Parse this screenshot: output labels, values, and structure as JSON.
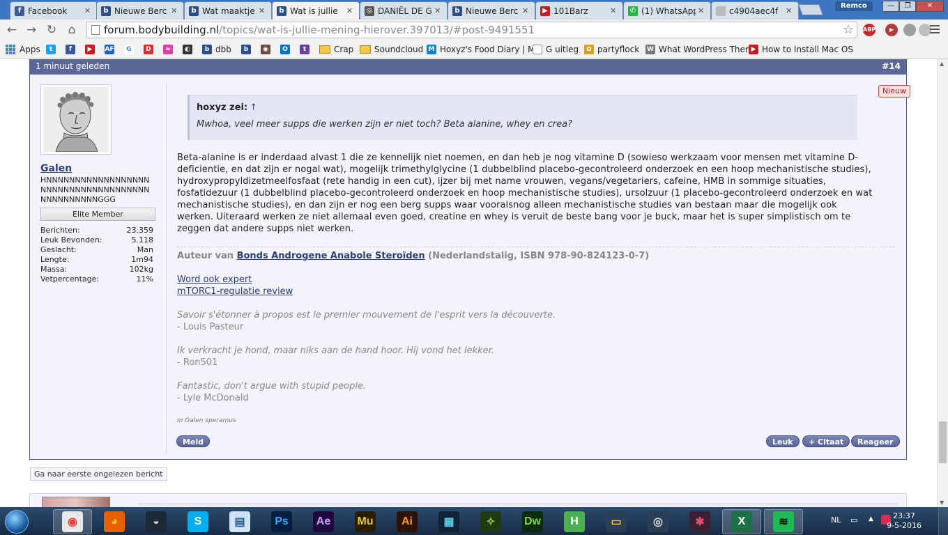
{
  "browser": {
    "tabs": [
      {
        "title": "Facebook",
        "color": "#3b5998",
        "glyph": "f",
        "active": false
      },
      {
        "title": "Nieuwe Berc",
        "color": "#2a4f8a",
        "glyph": "b",
        "active": false
      },
      {
        "title": "Wat maaktje",
        "color": "#2a4f8a",
        "glyph": "b",
        "active": false
      },
      {
        "title": "Wat is jullie",
        "color": "#2a4f8a",
        "glyph": "b",
        "active": true
      },
      {
        "title": "DANIËL DE G",
        "color": "#555555",
        "glyph": "◎",
        "active": false
      },
      {
        "title": "Nieuwe Berc",
        "color": "#2a4f8a",
        "glyph": "b",
        "active": false
      },
      {
        "title": "101Barz",
        "color": "#cc181e",
        "glyph": "▶",
        "active": false
      },
      {
        "title": "(1) WhatsApp",
        "color": "#2cb742",
        "glyph": "✆",
        "active": false
      },
      {
        "title": "c4904aec4f",
        "color": "#bbbbbb",
        "glyph": "",
        "active": false
      }
    ],
    "profile_name": "Remco",
    "url_host": "forum.bodybuilding.nl",
    "url_path": "/topics/wat-is-jullie-mening-hierover.397013/#post-9491551",
    "extensions": [
      {
        "name": "adblock-icon",
        "label": "ABP",
        "color": "#c62828"
      },
      {
        "name": "youtube-ext-icon",
        "label": "▶",
        "color": "#b43a3a"
      },
      {
        "name": "ext-grey-icon",
        "label": "",
        "color": "#9e9e9e"
      },
      {
        "name": "ext-grey2-icon",
        "label": "",
        "color": "#bdbdbd"
      }
    ],
    "bookmarks": [
      {
        "label": "Apps",
        "type": "apps"
      },
      {
        "label": "",
        "type": "icon",
        "color": "#1da1f2",
        "glyph": "t"
      },
      {
        "label": "",
        "type": "icon",
        "color": "#3b5998",
        "glyph": "f"
      },
      {
        "label": "",
        "type": "icon",
        "color": "#cc181e",
        "glyph": "▶"
      },
      {
        "label": "",
        "type": "icon",
        "color": "#1e63b5",
        "glyph": "AF"
      },
      {
        "label": "",
        "type": "icon",
        "color": "#ffffff",
        "glyph": "G"
      },
      {
        "label": "",
        "type": "icon",
        "color": "#d32f2f",
        "glyph": "D"
      },
      {
        "label": "",
        "type": "icon",
        "color": "#e040a0",
        "glyph": "∞"
      },
      {
        "label": "",
        "type": "icon",
        "color": "#333333",
        "glyph": "◐"
      },
      {
        "label": "dbb",
        "type": "icon",
        "color": "#2a4f8a",
        "glyph": "b"
      },
      {
        "label": "",
        "type": "icon",
        "color": "#2a4f8a",
        "glyph": "b"
      },
      {
        "label": "",
        "type": "icon",
        "color": "#6d4c41",
        "glyph": "◉"
      },
      {
        "label": "",
        "type": "icon",
        "color": "#0072c6",
        "glyph": "O"
      },
      {
        "label": "",
        "type": "icon",
        "color": "#6441a5",
        "glyph": "t"
      },
      {
        "label": "Crap",
        "type": "folder"
      },
      {
        "label": "Soundcloud",
        "type": "folder"
      },
      {
        "label": "Hoxyz's Food Diary | M",
        "type": "icon",
        "color": "#0d86c6",
        "glyph": "M"
      },
      {
        "label": "G uitleg",
        "type": "page"
      },
      {
        "label": "partyflock",
        "type": "icon",
        "color": "#d8a020",
        "glyph": "✿"
      },
      {
        "label": "What WordPress Then",
        "type": "icon",
        "color": "#777777",
        "glyph": "W"
      },
      {
        "label": "How to Install Mac OS",
        "type": "icon",
        "color": "#cc181e",
        "glyph": "▶"
      }
    ]
  },
  "post": {
    "time": "1 minuut geleden",
    "number": "#14",
    "new_badge": "Nieuw",
    "user": {
      "name": "Galen",
      "title": "HNNNNNNNNNNNNNNNNNNNNNNNNNNNNNNNNNNNNNNNNNNNNNNNGGG",
      "rank": "Elite Member",
      "stats": [
        {
          "label": "Berichten:",
          "value": "23.359"
        },
        {
          "label": "Leuk Bevonden:",
          "value": "5.118"
        },
        {
          "label": "Geslacht:",
          "value": "Man"
        },
        {
          "label": "Lengte:",
          "value": "1m94"
        },
        {
          "label": "Massa:",
          "value": "102kg"
        },
        {
          "label": "Vetpercentage:",
          "value": "11%"
        }
      ]
    },
    "quote": {
      "author": "hoxyz zei:",
      "arrow": "↑",
      "text": "Mwhoa, veel meer supps die werken zijn er niet toch? Beta alanine, whey en crea?"
    },
    "message": "Beta-alanine is er inderdaad alvast 1 die ze kennelijk niet noemen, en dan heb je nog vitamine D (sowieso werkzaam voor mensen met vitamine D-deficientie, en dat zijn er nogal wat), mogelijk trimethylglycine (1 dubbelblind placebo-gecontroleerd onderzoek en een hoop mechanistische studies), hydroxypropyldizetmeelfosfaat (rete handig in een cut), ijzer bij met name vrouwen, vegans/vegetariers, cafeine, HMB in sommige situaties, fosfatidezuur (1 dubbelblind placebo-gecontroleerd onderzoek en hoop mechanistische studies), ursolzuur (1 placebo-gecontroleerd onderzoek en wat mechanistische studies), en dan zijn er nog een berg supps waar vooralsnog alleen mechanistische studies van bestaan maar die mogelijk ook werken. Uiteraard werken ze niet allemaal even goed, creatine en whey is veruit de beste bang voor je buck, maar het is super simplistisch om te zeggen dat andere supps niet werken.",
    "signature": {
      "author_prefix": "Auteur van",
      "book_title": "Bonds Androgene Anabole Steroïden",
      "book_suffix": "(Nederlandstalig, ISBN 978-90-824123-0-7)",
      "link1": "Word ook expert",
      "link2": "mTORC1-regulatie review",
      "quotes": [
        {
          "text": "Savoir s'étonner à propos est le premier mouvement de l'esprit vers la découverte.",
          "by": "- Louis Pasteur"
        },
        {
          "text": "Ik verkracht je hond, maar niks aan de hand hoor. Hij vond het lekker.",
          "by": "- Ron501"
        },
        {
          "text": "Fantastic, don't argue with stupid people.",
          "by": "- Lyle McDonald"
        }
      ]
    },
    "in_galen": "In Galen speramus",
    "buttons": {
      "report": "Meld",
      "like": "Leuk",
      "quote": "+ Citaat",
      "reply": "Reageer"
    }
  },
  "first_unread": "Ga naar eerste ongelezen bericht",
  "taskbar": {
    "apps": [
      {
        "name": "chrome-icon",
        "glyph": "◉",
        "bg": "#e8e8e8",
        "fg": "#db4437",
        "active": true
      },
      {
        "name": "firefox-icon",
        "glyph": "◕",
        "bg": "#e66000",
        "fg": "#ffcc33",
        "active": false
      },
      {
        "name": "steam-icon",
        "glyph": "◒",
        "bg": "#1b2838",
        "fg": "#c7d5e0",
        "active": false
      },
      {
        "name": "skype-icon",
        "glyph": "S",
        "bg": "#00aff0",
        "fg": "#ffffff",
        "active": false
      },
      {
        "name": "explorer-icon",
        "glyph": "▤",
        "bg": "#cfe3f7",
        "fg": "#2a5a8a",
        "active": false
      },
      {
        "name": "photoshop-icon",
        "glyph": "Ps",
        "bg": "#061e3f",
        "fg": "#31a8ff",
        "active": false
      },
      {
        "name": "after-effects-icon",
        "glyph": "Ae",
        "bg": "#1f0740",
        "fg": "#d59cff",
        "active": false
      },
      {
        "name": "muse-icon",
        "glyph": "Mu",
        "bg": "#2b1e00",
        "fg": "#e8c33a",
        "active": false
      },
      {
        "name": "illustrator-icon",
        "glyph": "Ai",
        "bg": "#2e1300",
        "fg": "#ff9a00",
        "active": false
      },
      {
        "name": "video-editor-icon",
        "glyph": "▦",
        "bg": "#0f2436",
        "fg": "#5ec8e6",
        "active": false
      },
      {
        "name": "fl-studio-icon",
        "glyph": "✧",
        "bg": "#1e3a10",
        "fg": "#9cd43c",
        "active": false
      },
      {
        "name": "dreamweaver-icon",
        "glyph": "Dw",
        "bg": "#0e2b0e",
        "fg": "#7fd84a",
        "active": false
      },
      {
        "name": "h-app-icon",
        "glyph": "H",
        "bg": "#4caf50",
        "fg": "#ffffff",
        "active": false
      },
      {
        "name": "monitor-app-icon",
        "glyph": "▭",
        "bg": "#2a3f55",
        "fg": "#f2c230",
        "active": false
      },
      {
        "name": "circle-app-icon",
        "glyph": "◎",
        "bg": "#2a3f55",
        "fg": "#dddddd",
        "active": false
      },
      {
        "name": "game-app-icon",
        "glyph": "✱",
        "bg": "#3a2030",
        "fg": "#e05070",
        "active": false
      },
      {
        "name": "excel-icon",
        "glyph": "X",
        "bg": "#1e7145",
        "fg": "#ffffff",
        "active": true
      },
      {
        "name": "spotify-icon",
        "glyph": "≋",
        "bg": "#1db954",
        "fg": "#000000",
        "active": true
      }
    ],
    "lang": "NL",
    "time": "23:37",
    "date": "9-5-2016"
  }
}
